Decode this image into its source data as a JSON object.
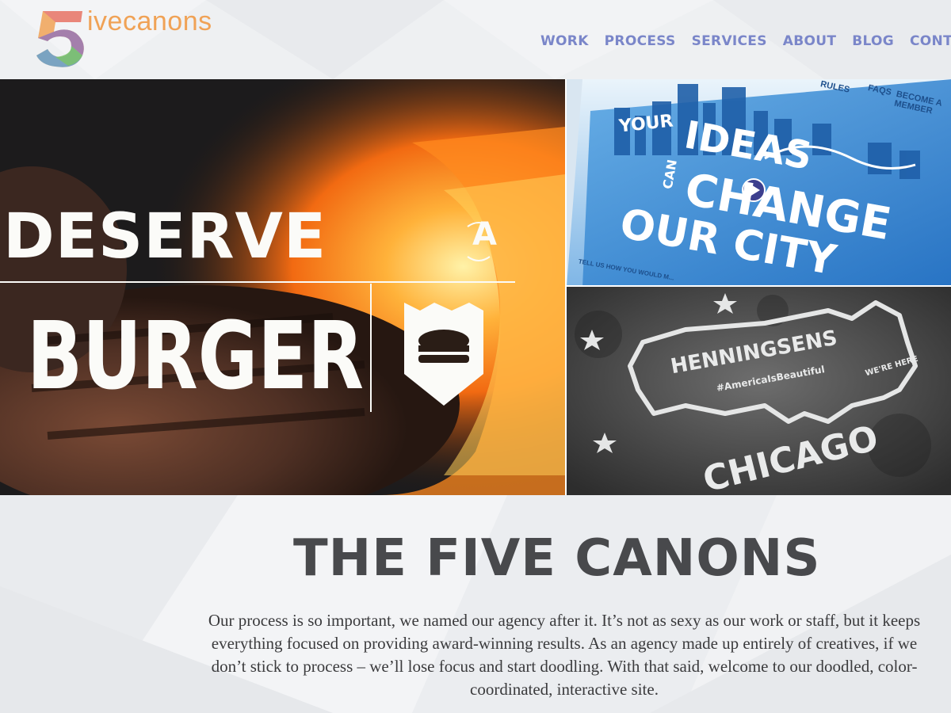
{
  "brand": {
    "logo_numeral": "5",
    "logo_word": "ivecanons",
    "accent_color": "#f0a256"
  },
  "nav": {
    "items": [
      "WORK",
      "PROCESS",
      "SERVICES",
      "ABOUT",
      "BLOG",
      "CONTACT"
    ],
    "color": "#7a86c9"
  },
  "hero": {
    "burger_panel": {
      "line1": "DESERVE",
      "line2": "A",
      "line3": "BURGER"
    },
    "ideas_panel": {
      "menu": [
        "RULES",
        "FAQS",
        "BECOME A MEMBER"
      ],
      "line1": "YOUR",
      "line2": "IDEAS",
      "line3": "CAN",
      "line4": "CHANGE",
      "line5": "OUR CITY",
      "footer_note": "TELL US HOW YOU WOULD M..."
    },
    "chicago_panel": {
      "brand": "HENNINGSENS",
      "tag": "#AmericaIsBeautiful",
      "note": "WE'RE HERE",
      "city": "CHICAGO"
    }
  },
  "content": {
    "title": "THE FIVE CANONS",
    "body": "Our process is so important, we named our agency after it. It’s not as sexy as our work or staff, but it keeps everything focused on providing award-winning results. As an agency made up entirely of creatives, if we don’t stick to process – we’ll lose focus and start doodling. With that said, welcome to our doodled, color-coordinated, interactive site."
  }
}
